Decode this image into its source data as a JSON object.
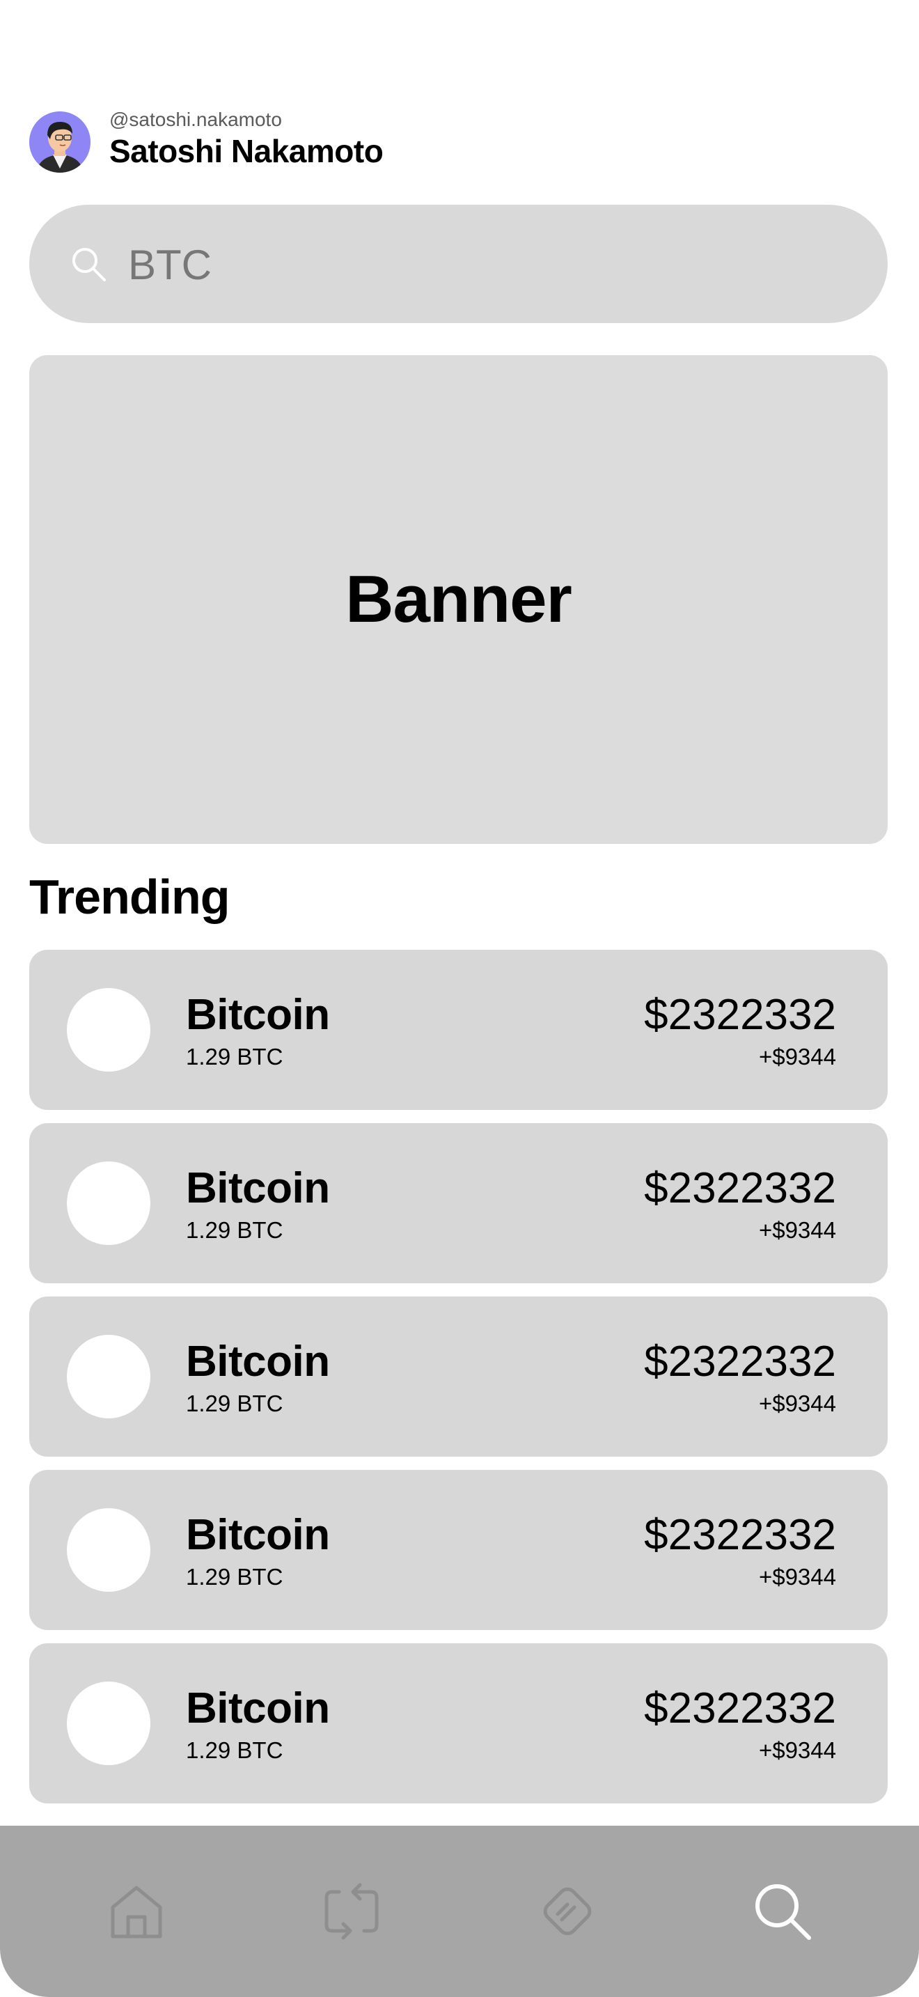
{
  "profile": {
    "handle": "@satoshi.nakamoto",
    "name": "Satoshi Nakamoto"
  },
  "search": {
    "value": "BTC",
    "icon": "search-icon"
  },
  "banner": {
    "label": "Banner"
  },
  "trending": {
    "title": "Trending",
    "items": [
      {
        "name": "Bitcoin",
        "amount": "1.29 BTC",
        "price": "$2322332",
        "change": "+$9344"
      },
      {
        "name": "Bitcoin",
        "amount": "1.29 BTC",
        "price": "$2322332",
        "change": "+$9344"
      },
      {
        "name": "Bitcoin",
        "amount": "1.29 BTC",
        "price": "$2322332",
        "change": "+$9344"
      },
      {
        "name": "Bitcoin",
        "amount": "1.29 BTC",
        "price": "$2322332",
        "change": "+$9344"
      },
      {
        "name": "Bitcoin",
        "amount": "1.29 BTC",
        "price": "$2322332",
        "change": "+$9344"
      }
    ]
  },
  "nav": {
    "items": [
      {
        "icon": "home-icon",
        "active": false
      },
      {
        "icon": "swap-icon",
        "active": false
      },
      {
        "icon": "ticket-icon",
        "active": false
      },
      {
        "icon": "search-icon",
        "active": true
      }
    ]
  },
  "colors": {
    "card": "#d7d7d7",
    "search_bg": "#d9d9d9",
    "nav_bg": "#a6a6a6",
    "nav_inactive": "#8e8e8e",
    "nav_active": "#ffffff",
    "avatar_bg": "#8f86f5"
  }
}
